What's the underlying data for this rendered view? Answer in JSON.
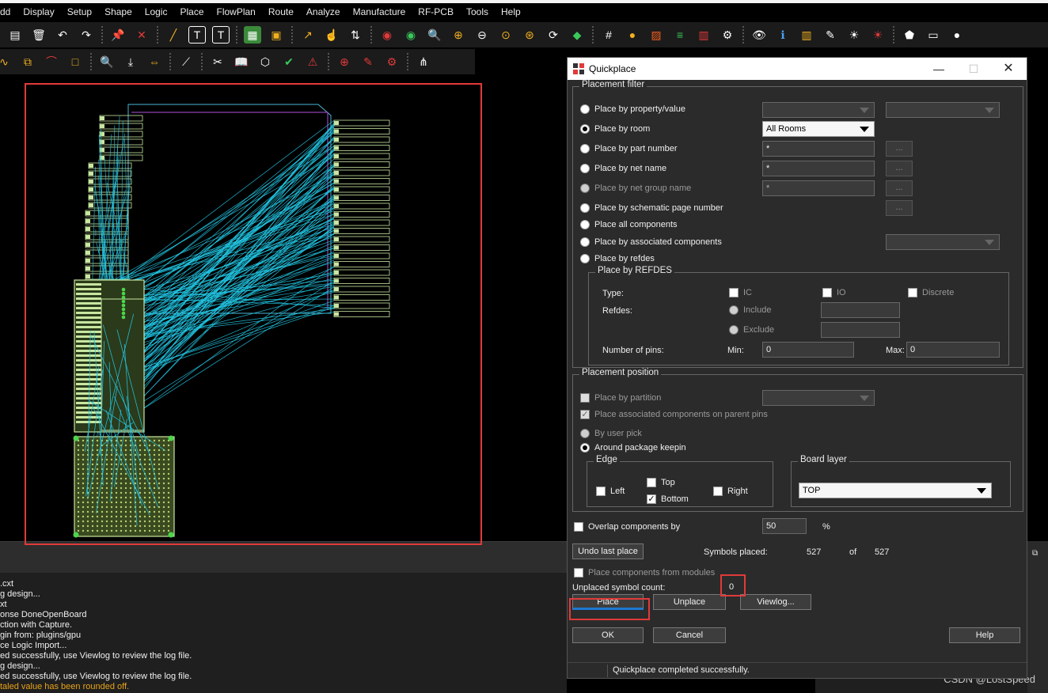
{
  "menu": [
    "dd",
    "Display",
    "Setup",
    "Shape",
    "Logic",
    "Place",
    "FlowPlan",
    "Route",
    "Analyze",
    "Manufacture",
    "RF-PCB",
    "Tools",
    "Help"
  ],
  "toolbar_icons": [
    "new-icon",
    "delete-icon",
    "undo-icon",
    "redo-icon",
    "pin-icon",
    "unpin-icon",
    "add-line-icon",
    "text-icon",
    "text-edit-icon",
    "component-icon",
    "place-icon",
    "route-icon",
    "fanout-icon",
    "drc-icon",
    "zoom-fit-icon",
    "zoom-in-icon",
    "zoom-out-icon",
    "zoom-prev-icon",
    "zoom-world-icon",
    "refresh-icon",
    "board-icon",
    "grid-icon",
    "color-icon",
    "layers-icon",
    "stack-icon",
    "report-icon",
    "settings-icon",
    "visibility-icon",
    "info-icon",
    "measure-icon",
    "highlight-icon",
    "light-icon",
    "dehighlight-icon",
    "shape-add-icon",
    "void-icon",
    "pin-swap-icon"
  ],
  "log": {
    "lines": [
      ".cxt",
      "g design...",
      "xt",
      "onse DoneOpenBoard",
      "ction with Capture.",
      "gin from: plugins/gpu",
      "ce Logic Import...",
      "ed successfully, use Viewlog to review the log file.",
      "g design...",
      "ed successfully, use Viewlog to review the log file."
    ],
    "warning": "taled value has been rounded off."
  },
  "watermark": "CSDN @LostSpeed",
  "dialog": {
    "title": "Quickplace",
    "filter": {
      "legend": "Placement filter",
      "options": {
        "property": "Place by property/value",
        "room": "Place by room",
        "part": "Place by part number",
        "net": "Place by net name",
        "netgroup": "Place by net group name",
        "schematic": "Place by schematic page number",
        "all": "Place all components",
        "associated": "Place by associated components",
        "refdes": "Place by refdes"
      },
      "room_value": "All Rooms",
      "part_value": "*",
      "net_value": "*",
      "netgroup_value": "*",
      "dots": "...",
      "refdes_group": {
        "legend": "Place by REFDES",
        "type_label": "Type:",
        "ic": "IC",
        "io": "IO",
        "discrete": "Discrete",
        "refdes_label": "Refdes:",
        "include": "Include",
        "exclude": "Exclude",
        "pins_label": "Number of pins:",
        "min_label": "Min:",
        "min_value": "0",
        "max_label": "Max:",
        "max_value": "0"
      }
    },
    "position": {
      "legend": "Placement position",
      "partition": "Place by partition",
      "associated_parent": "Place associated components on parent pins",
      "user_pick": "By user pick",
      "around_keepin": "Around package keepin",
      "edge": {
        "legend": "Edge",
        "top": "Top",
        "left": "Left",
        "bottom": "Bottom",
        "right": "Right"
      },
      "board_layer": {
        "legend": "Board layer",
        "value": "TOP"
      }
    },
    "overlap_label": "Overlap components by",
    "overlap_value": "50",
    "overlap_unit": "%",
    "undo_button": "Undo last place",
    "symbols_placed_label": "Symbols placed:",
    "symbols_placed": "527",
    "of_label": "of",
    "symbols_total": "527",
    "modules_label": "Place components from modules",
    "unplaced_label": "Unplaced symbol count:",
    "unplaced_value": "0",
    "place_button": "Place",
    "unplace_button": "Unplace",
    "viewlog_button": "Viewlog...",
    "ok_button": "OK",
    "cancel_button": "Cancel",
    "help_button": "Help",
    "status": "Quickplace completed successfully."
  },
  "colors": {
    "ratsnest": "#22c8e6",
    "component": "#c8e6a0",
    "highlight_box": "#e23a3a",
    "accent": "#1e78d2"
  }
}
